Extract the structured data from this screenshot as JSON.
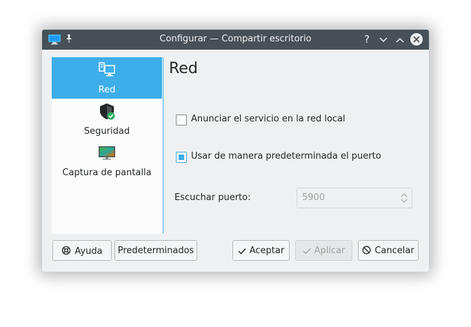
{
  "window": {
    "title": "Configurar — Compartir escritorio",
    "help_glyph": "?",
    "minimize_glyph": "⌄",
    "maximize_glyph": "⌃"
  },
  "sidebar": {
    "items": [
      {
        "label": "Red",
        "icon": "network-icon",
        "active": true
      },
      {
        "label": "Seguridad",
        "icon": "security-shield-icon",
        "active": false
      },
      {
        "label": "Captura de pantalla",
        "icon": "screen-capture-icon",
        "active": false
      }
    ]
  },
  "page": {
    "title": "Red",
    "announce_label": "Anunciar el servicio en la red local",
    "announce_checked": false,
    "default_port_label": "Usar de manera predeterminada el puerto",
    "default_port_checked": true,
    "listen_port_label": "Escuchar puerto:",
    "listen_port_value": "5900"
  },
  "buttons": {
    "help": "Ayuda",
    "defaults": "Predeterminados",
    "accept": "Aceptar",
    "apply": "Aplicar",
    "cancel": "Cancelar"
  },
  "colors": {
    "accent": "#3daee9",
    "titlebar": "#475057",
    "window_bg": "#eff0f1"
  }
}
